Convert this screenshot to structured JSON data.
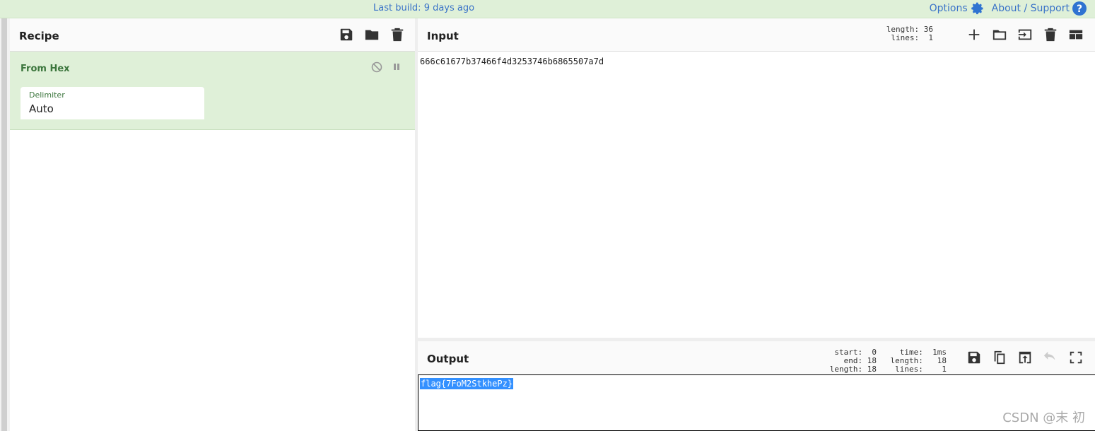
{
  "topbar": {
    "build": "Last build: 9 days ago",
    "options": "Options",
    "about": "About / Support"
  },
  "recipe": {
    "title": "Recipe",
    "operation": {
      "name": "From Hex",
      "delimiter_label": "Delimiter",
      "delimiter_value": "Auto"
    }
  },
  "input": {
    "title": "Input",
    "stats": "length: 36\n lines:  1",
    "value": "666c61677b37466f4d3253746b6865507a7d"
  },
  "output": {
    "title": "Output",
    "stats_left": "start:  0\n  end: 18\nlength: 18",
    "stats_right": "  time:  1ms\nlength:   18\n lines:    1",
    "value": "flag{7FoM2StkhePz}"
  },
  "watermark": "CSDN @末 初",
  "colors": {
    "accent": "#3a73c8",
    "op_bg": "#dff0d8",
    "op_text": "#3c763d",
    "selection": "#3390ff"
  }
}
